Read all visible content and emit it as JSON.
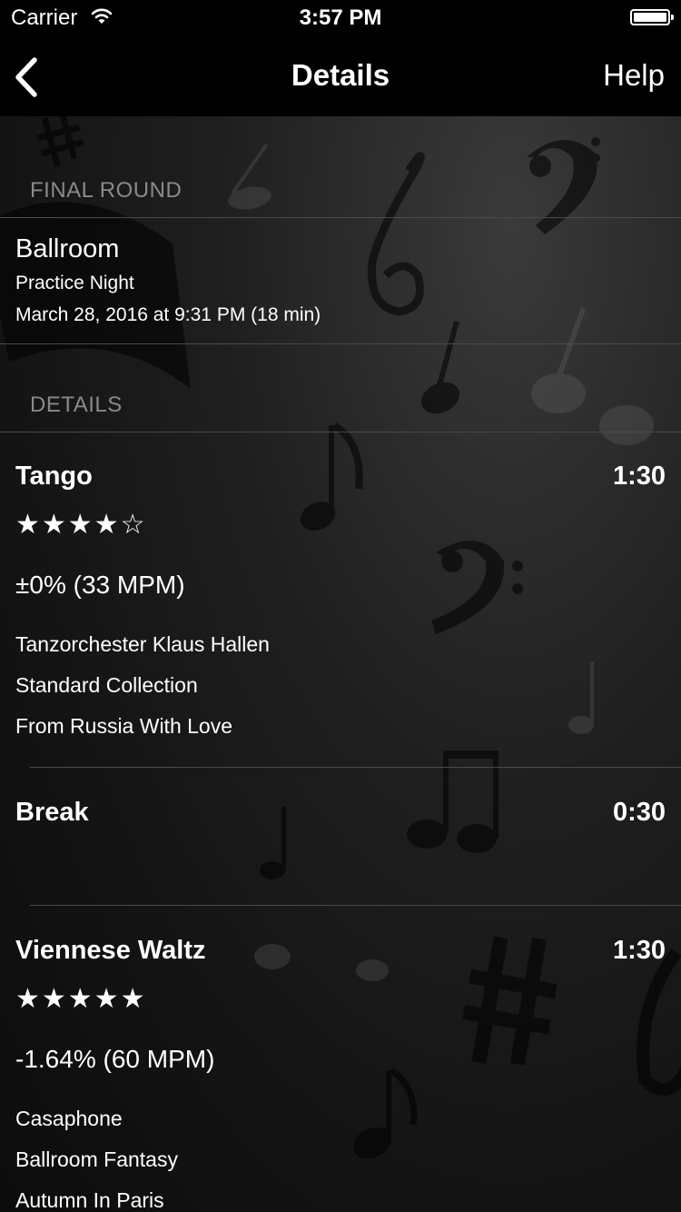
{
  "status_bar": {
    "carrier": "Carrier",
    "time": "3:57 PM"
  },
  "nav": {
    "title": "Details",
    "help_label": "Help",
    "back_icon": "chevron-left-icon"
  },
  "session": {
    "section_header": "FINAL ROUND",
    "title": "Ballroom",
    "subtitle": "Practice Night",
    "datetime": "March 28, 2016 at 9:31 PM (18 min)"
  },
  "details": {
    "section_header": "DETAILS",
    "items": [
      {
        "name": "Tango",
        "duration": "1:30",
        "stars": "★★★★☆",
        "rating": 4,
        "tempo": "±0% (33 MPM)",
        "artist": "Tanzorchester Klaus Hallen",
        "album": "Standard Collection",
        "track": "From Russia With Love"
      },
      {
        "name": "Break",
        "duration": "0:30"
      },
      {
        "name": "Viennese Waltz",
        "duration": "1:30",
        "stars": "★★★★★",
        "rating": 5,
        "tempo": "-1.64% (60 MPM)",
        "artist": "Casaphone",
        "album": "Ballroom Fantasy",
        "track": "Autumn In Paris"
      }
    ]
  }
}
